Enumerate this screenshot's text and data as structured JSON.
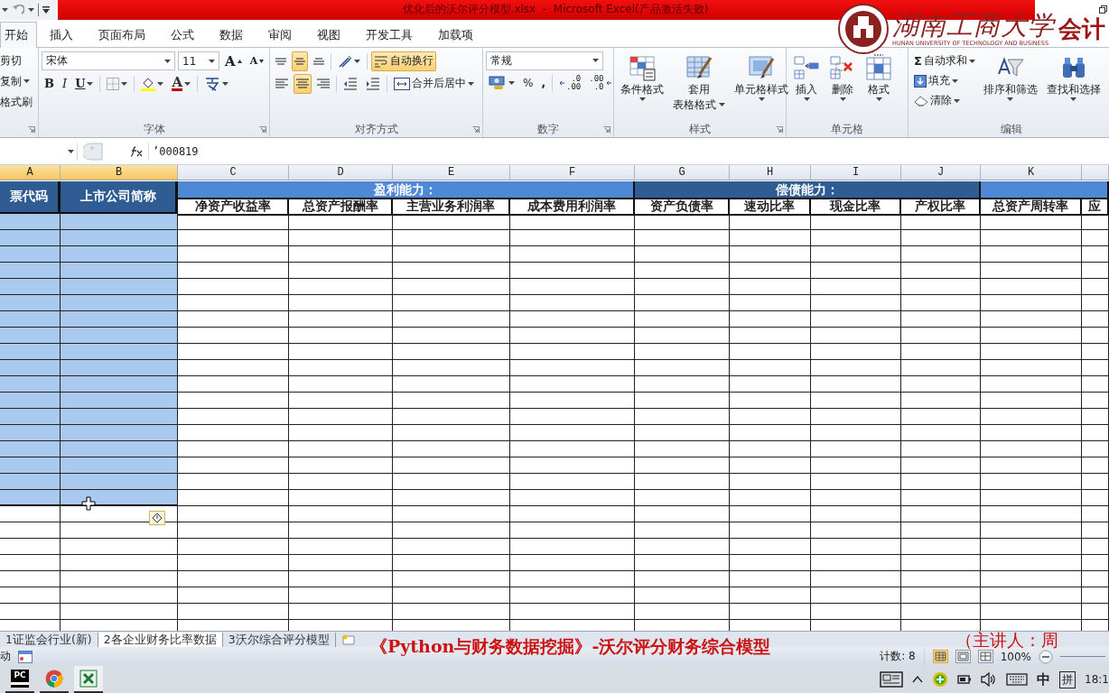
{
  "window": {
    "title": "优化后的沃尔评分模型.xlsx  -  Microsoft Excel(产品激活失败)"
  },
  "overlay_logo": {
    "name": "湖南工商大学",
    "subtitle": "HUNAN UNIVERSITY OF TECHNOLOGY AND BUSINESS",
    "tag": "会计"
  },
  "ribbon_tabs": [
    {
      "label": "开始",
      "selected": true
    },
    {
      "label": "插入",
      "selected": false
    },
    {
      "label": "页面布局",
      "selected": false
    },
    {
      "label": "公式",
      "selected": false
    },
    {
      "label": "数据",
      "selected": false
    },
    {
      "label": "审阅",
      "selected": false
    },
    {
      "label": "视图",
      "selected": false
    },
    {
      "label": "开发工具",
      "selected": false
    },
    {
      "label": "加载项",
      "selected": false
    }
  ],
  "ribbon": {
    "clipboard": {
      "items": [
        {
          "label": "剪切",
          "dropdown": false
        },
        {
          "label": "复制",
          "dropdown": true
        },
        {
          "label": "格式刷",
          "dropdown": false
        }
      ]
    },
    "font": {
      "title": "字体",
      "font_name": "宋体",
      "font_size": "11",
      "grow": "A",
      "shrink": "A",
      "bold": "B",
      "italic": "I",
      "underline": "U",
      "font_color": "A"
    },
    "alignment": {
      "title": "对齐方式",
      "vertical": [
        {
          "kind": "top",
          "selected": false
        },
        {
          "kind": "middle",
          "selected": true
        },
        {
          "kind": "bottom",
          "selected": false
        }
      ],
      "horizontal": [
        {
          "kind": "left",
          "selected": false
        },
        {
          "kind": "center",
          "selected": true
        },
        {
          "kind": "right",
          "selected": false
        }
      ],
      "wrap_text": {
        "label": "自动换行",
        "selected": true
      },
      "merge": "合并后居中"
    },
    "number": {
      "title": "数字",
      "format": "常规",
      "percent": "%",
      "comma": ",",
      "decimals": [
        {
          "kind": "increase",
          "top": ".0",
          "bottom": ".00"
        },
        {
          "kind": "decrease",
          "top": ".00",
          "bottom": ".0"
        }
      ]
    },
    "styles": {
      "title": "样式",
      "buttons": [
        {
          "kind": "conditional",
          "lines": [
            "条件格式"
          ]
        },
        {
          "kind": "table",
          "lines": [
            "套用",
            "表格格式"
          ]
        },
        {
          "kind": "cell_style",
          "lines": [
            "单元格样式"
          ]
        }
      ]
    },
    "cells": {
      "title": "单元格",
      "buttons": [
        {
          "kind": "insert",
          "lines": [
            "插入"
          ]
        },
        {
          "kind": "delete",
          "lines": [
            "删除"
          ]
        },
        {
          "kind": "format",
          "lines": [
            "格式"
          ]
        }
      ]
    },
    "editing": {
      "title": "编辑",
      "small": [
        {
          "kind": "sum",
          "symbol": "Σ",
          "label": "自动求和"
        },
        {
          "kind": "fill",
          "label": "填充"
        },
        {
          "kind": "clear",
          "label": "清除"
        }
      ],
      "large": [
        {
          "kind": "sort",
          "lines": [
            "排序和筛选"
          ]
        },
        {
          "kind": "find",
          "lines": [
            "查找和选择"
          ]
        }
      ]
    }
  },
  "formula_bar": {
    "formula": "’000819"
  },
  "columns": [
    {
      "letter": "A",
      "selected": true
    },
    {
      "letter": "B",
      "selected": true
    },
    {
      "letter": "C",
      "selected": false
    },
    {
      "letter": "D",
      "selected": false
    },
    {
      "letter": "E",
      "selected": false
    },
    {
      "letter": "F",
      "selected": false
    },
    {
      "letter": "G",
      "selected": false
    },
    {
      "letter": "H",
      "selected": false
    },
    {
      "letter": "I",
      "selected": false
    },
    {
      "letter": "J",
      "selected": false
    },
    {
      "letter": "K",
      "selected": false
    }
  ],
  "sheet": {
    "id_headers": [
      "票代码",
      "上市公司简称"
    ],
    "groups": [
      {
        "label": "盈利能力：",
        "color": "#4f88d4",
        "columns": [
          "净资产收益率",
          "总资产报酬率",
          "主营业务利润率",
          "成本费用利润率"
        ]
      },
      {
        "label": "偿债能力：",
        "color": "#2f5d93",
        "columns": [
          "资产负债率",
          "速动比率",
          "现金比率",
          "产权比率"
        ]
      },
      {
        "color": "#4f88d4",
        "columns": [
          "总资产周转率",
          "应"
        ]
      }
    ]
  },
  "sheet_tabs": [
    {
      "label": "1证监会行业(新)",
      "selected": false
    },
    {
      "label": "2各企业财务比率数据",
      "selected": true
    },
    {
      "label": "3沃尔综合评分模型",
      "selected": false
    }
  ],
  "status_bar": {
    "mode": "动",
    "count": "计数: 8",
    "zoom": "100%",
    "views": [
      {
        "kind": "normal",
        "selected": true
      },
      {
        "kind": "page_layout",
        "selected": false
      },
      {
        "kind": "page_break",
        "selected": false
      }
    ]
  },
  "caption": {
    "title": "《Python与财务数据挖掘》-沃尔评分财务综合模型",
    "presenter": "（主讲人：周"
  },
  "taskbar": {
    "apps": [
      {
        "kind": "pycharm",
        "label": "PC",
        "selected": false
      },
      {
        "kind": "chrome",
        "selected": false
      },
      {
        "kind": "excel",
        "selected": true
      }
    ],
    "ime": "中",
    "ime_mode": "拼",
    "clock": "18:1"
  }
}
